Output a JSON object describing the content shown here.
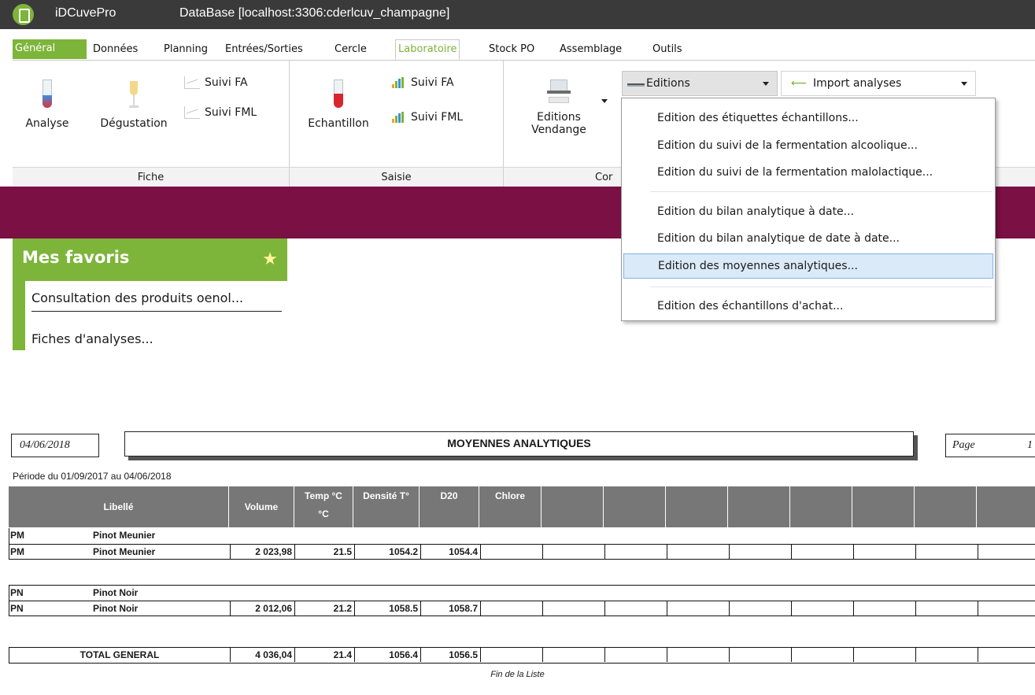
{
  "window": {
    "app_name": "iDCuvePro",
    "db_title": "DataBase [localhost:3306:cderlcuv_champagne]"
  },
  "menu": {
    "tabs": [
      "Général",
      "Données",
      "Planning",
      "Entrées/Sorties",
      "Cercle",
      "Laboratoire",
      "Stock PO",
      "Assemblage",
      "Outils"
    ],
    "active": "Laboratoire"
  },
  "ribbon": {
    "fiche": {
      "label": "Fiche",
      "analyse": "Analyse",
      "degustation": "Dégustation",
      "suivi_fa": "Suivi FA",
      "suivi_fml": "Suivi FML"
    },
    "saisie": {
      "label": "Saisie",
      "echantillon": "Echantillon",
      "suivi_fa": "Suivi FA",
      "suivi_fml": "Suivi FML"
    },
    "consultation": {
      "label_partial": "Cor",
      "editions_vendange": [
        "Editions",
        "Vendange"
      ]
    },
    "editions_dropdown": "Editions",
    "import_dropdown": "Import analyses"
  },
  "editions_menu": {
    "items": [
      "Edition des étiquettes échantillons...",
      "Edition du suivi de la fermentation alcoolique...",
      "Edition du suivi de la fermentation malolactique...",
      "Edition du bilan analytique à date...",
      "Edition du bilan analytique de date à date...",
      "Edition des moyennes analytiques...",
      "Edition des échantillons d'achat..."
    ],
    "highlighted_index": 5
  },
  "favoris": {
    "title": "Mes favoris",
    "items": [
      "Consultation des produits oenol...",
      "Fiches d'analyses..."
    ]
  },
  "report": {
    "date": "04/06/2018",
    "title": "MOYENNES ANALYTIQUES",
    "page_label": "Page",
    "page_number": "1",
    "period": "Période du 01/09/2017 au 04/06/2018",
    "headers": [
      "Libellé",
      "Volume",
      "Temp °C",
      "°C",
      "Densité T°",
      "D20",
      "Chlore"
    ],
    "rows": [
      {
        "code": "PM",
        "name": "Pinot Meunier",
        "group": true
      },
      {
        "code": "PM",
        "name": "Pinot Meunier",
        "volume": "2 023,98",
        "temp": "21.5",
        "densite": "1054.2",
        "d20": "1054.4"
      },
      {
        "code": "PN",
        "name": "Pinot Noir",
        "group": true
      },
      {
        "code": "PN",
        "name": "Pinot Noir",
        "volume": "2 012,06",
        "temp": "21.2",
        "densite": "1058.5",
        "d20": "1058.7"
      }
    ],
    "total": {
      "label": "TOTAL GENERAL",
      "volume": "4 036,04",
      "temp": "21.4",
      "densite": "1056.4",
      "d20": "1056.5"
    },
    "footer": "Fin de la Liste"
  },
  "colors": {
    "accent_green": "#7db43a",
    "banner_purple": "#7a1043",
    "titlebar": "#3a3a3a"
  }
}
